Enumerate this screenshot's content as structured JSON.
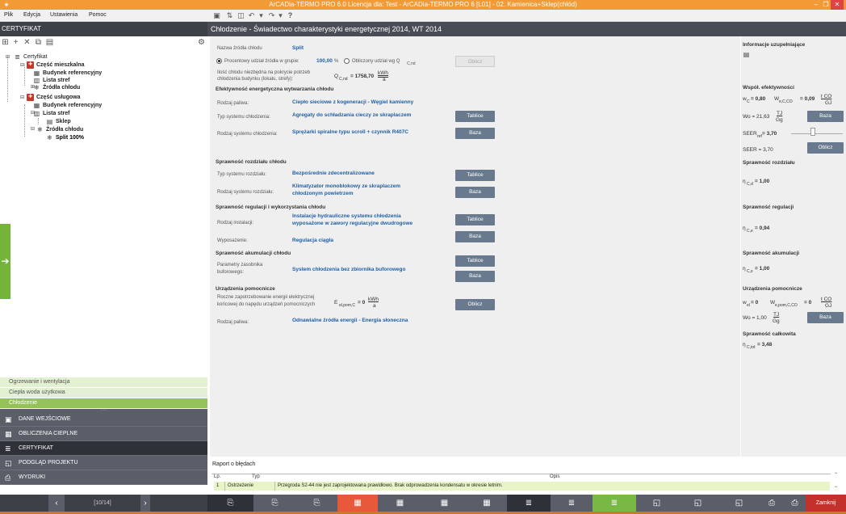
{
  "title": "ArCADia-TERMO PRO 6.0 Licencja dla: Test - ArCADia-TERMO PRO 6 [L01] - 02. Kamienica+Sklep(chłód)",
  "window_controls": {
    "minimize": "–",
    "restore": "❐",
    "close": "✕"
  },
  "menu": [
    "Plik",
    "Edycja",
    "Ustawienia",
    "Pomoc"
  ],
  "left": {
    "header": "CERTYFIKAT",
    "tree": [
      {
        "label": "Certyfikat",
        "bold": false
      },
      {
        "label": "Część mieszkalna",
        "bold": true
      },
      {
        "label": "Budynek referencyjny",
        "bold": true
      },
      {
        "label": "Lista stref",
        "bold": true
      },
      {
        "label": "Źródła chłodu",
        "bold": true
      },
      {
        "label": "Część usługowa",
        "bold": true
      },
      {
        "label": "Budynek referencyjny",
        "bold": true
      },
      {
        "label": "Lista stref",
        "bold": true
      },
      {
        "label": "Sklep",
        "bold": true
      },
      {
        "label": "Źródła chłodu",
        "bold": true
      },
      {
        "label": "Split 100%",
        "bold": true
      }
    ],
    "subtabs": [
      "Ogrzewanie i wentylacja",
      "Ciepła woda użytkowa",
      "Chłodzenie"
    ],
    "nav": [
      "DANE WEJŚCIOWE",
      "OBLICZENIA CIEPLNE",
      "CERTYFIKAT",
      "PODGLĄD PROJEKTU",
      "WYDRUKI"
    ],
    "pager": "[10/14]"
  },
  "main": {
    "header": "Chłodzenie - Świadectwo charakterystyki energetycznej 2014, WT 2014",
    "name_label": "Nazwa źródła chłodu",
    "name_value": "Split",
    "radio1": "Procentowy udział źródła w grupie:",
    "radio1_value": "100,00",
    "radio1_unit": "%",
    "radio2": "Obliczony udział wg Q",
    "radio2_sub": "C,nd",
    "calc_btn": "Oblicz",
    "qnd_label1": "Ilość chłodu niezbędna na pokrycie potrzeb",
    "qnd_label2": "chłodzenia budynku (lokalu, strefy):",
    "qnd_sym": "Q",
    "qnd_sub": "C,nd",
    "qnd_value": "= 1758,70",
    "qnd_unit_num": "kWh",
    "qnd_unit_den": "a",
    "sec1": "Efektywność energetyczna wytwarzania chłodu",
    "fuel_label": "Rodzaj paliwa:",
    "fuel_value": "Ciepło sieciowe z kogeneracji - Węgiel kamienny",
    "systype_label": "Typ systemu chłodzenia:",
    "systype_value": "Agregaty do schładzania cieczy ze skraplaczem",
    "sysgen_label": "Rodzaj systemu chłodzenia:",
    "sysgen_value": "Sprężarki spiralne typu scroll + czynnik R407C",
    "sec2": "Sprawność rozdziału chłodu",
    "disttype_label": "Typ systemu rozdziału:",
    "disttype_value": "Bezpośrednie zdecentralizowane",
    "distkind_label": "Rodzaj systemu rozdziału:",
    "distkind_value1": "Klimatyzator monoblokowy ze skraplaczem",
    "distkind_value2": "chłodzonym powietrzem",
    "sec3": "Sprawność regulacji i wykorzystania chłodu",
    "inst_label": "Rodzaj instalacji:",
    "inst_value1": "Instalacje hydrauliczne systemu chłodzenia",
    "inst_value2": "wyposażone w zawory regulacyjne dwudrogowe",
    "equip_label": "Wyposażenie:",
    "equip_value": "Regulacja ciągła",
    "sec4": "Sprawność akumulacji chłodu",
    "tank_label1": "Parametry zasobnika",
    "tank_label2": "buforowego:",
    "tank_value": "System chłodzenia bez zbiornika buforowego",
    "sec5": "Urządzenia pomocnicze",
    "aux_label1": "Roczne zapotrzebowanie energii elektrycznej",
    "aux_label2": "końcowej do napędu urządzeń pomocniczych",
    "aux_sym": "E",
    "aux_sub": "el,pom,C",
    "aux_value": "= 0",
    "aux_unit_num": "kWh",
    "aux_unit_den": "a",
    "aux_fuel_label": "Rodzaj paliwa:",
    "aux_fuel_value": "Odnawialne źródła energii - Energia słoneczna",
    "btn_tablice": "Tablice",
    "btn_baza": "Baza",
    "btn_oblicz": "Oblicz"
  },
  "right": {
    "info_title": "Informacje uzupełniające",
    "eff_title": "Współ. efektywności",
    "wc": "w",
    "wc_sub": "C",
    "wc_value": "= 0,80",
    "wco2": "W",
    "wco2_sub": "e,C,CO",
    "wco2_value": "= 0,09",
    "wco2_unit_num": "t CO",
    "wco2_unit_den": "GJ",
    "wo_label": "Wo = 21,63",
    "wo_unit_num": "TJ",
    "wo_unit_den": "Gg",
    "seer_ref": "SEER",
    "seer_ref_sub": "ref",
    "seer_ref_value": "= 3,70",
    "seer": "SEER = 3,70",
    "dist_title": "Sprawność rozdziału",
    "eta_d": "η",
    "eta_d_sub": "C,d",
    "eta_d_value": "= 1,00",
    "reg_title": "Sprawność regulacji",
    "eta_e": "η",
    "eta_e_sub": "C,e",
    "eta_e_value": "= 0,94",
    "acc_title": "Sprawność akumulacji",
    "eta_s": "η",
    "eta_s_sub": "C,s",
    "eta_s_value": "= 1,00",
    "aux_title": "Urządzenia pomocnicze",
    "wel": "w",
    "wel_sub": "el",
    "wel_value": "= 0",
    "wel2": "W",
    "wel2_sub": "e,pom,C,CO",
    "wel2_value": "= 0",
    "wel2_unit_num": "t CO",
    "wel2_unit_den": "GJ",
    "wo2_label": "Wo = 1,00",
    "wo2_unit_num": "TJ",
    "wo2_unit_den": "Gg",
    "tot_title": "Sprawność całkowita",
    "eta_tot": "η",
    "eta_tot_sub": "C,tot",
    "eta_tot_value": "= 3,48",
    "btn_baza": "Baza",
    "btn_oblicz": "Oblicz"
  },
  "errors": {
    "title": "Raport o błędach",
    "col_lp": "Lp.",
    "col_typ": "Typ",
    "col_opis": "Opis",
    "rows": [
      {
        "lp": "1",
        "typ": "Ostrzeżenie",
        "opis": "Przegroda S2-44 nie jest zaprojektowana prawidłowo. Brak odprowadzenia kondensatu w okresie letnim."
      }
    ]
  },
  "bottom": {
    "close_label": "Zamknij"
  }
}
